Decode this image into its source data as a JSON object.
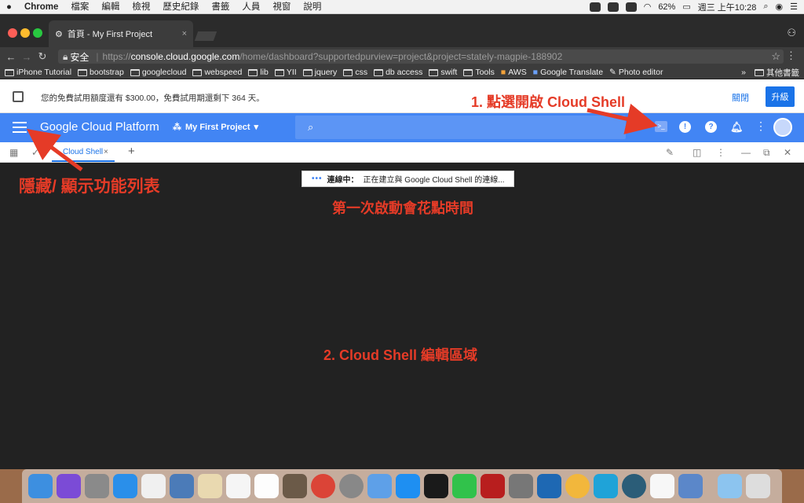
{
  "menubar": {
    "apple": "",
    "app": "Chrome",
    "items": [
      "檔案",
      "編輯",
      "檢視",
      "歷史紀錄",
      "書籤",
      "人員",
      "視窗",
      "說明"
    ],
    "battery": "62%",
    "clock": "週三 上午10:28"
  },
  "browser": {
    "tab_title": "首頁 - My First Project",
    "tab_close": "×",
    "secure_label": "安全",
    "url_scheme": "https://",
    "url_host": "console.cloud.google.com",
    "url_path": "/home/dashboard?supportedpurview=project&project=stately-magpie-188902"
  },
  "bookmarks": {
    "items": [
      "iPhone Tutorial",
      "bootstrap",
      "googlecloud",
      "webspeed",
      "lib",
      "YII",
      "jquery",
      "css",
      "db access",
      "swift",
      "Tools",
      "AWS",
      "Google Translate",
      "Photo editor"
    ],
    "overflow": "»",
    "other": "其他書籤"
  },
  "promo": {
    "text": "您的免費試用額度還有 $300.00，免費試用期還剩下 364 天。",
    "dismiss": "關閉",
    "upgrade": "升級"
  },
  "gcp": {
    "title": "Google Cloud Platform",
    "project": "My First Project"
  },
  "shell": {
    "tab_label": "Cloud Shell",
    "tab_close": "×",
    "add": "+",
    "connecting_label": "連線中：",
    "connecting_text": "正在建立與 Google Cloud Shell 的連線..."
  },
  "annotations": {
    "step1": "1. 點選開啟 Cloud Shell",
    "menu_toggle": "隱藏/ 顯示功能列表",
    "first_start": "第一次啟動會花點時間",
    "step2": "2. Cloud Shell 編輯區域"
  },
  "colors": {
    "gcp_blue": "#4285f4",
    "annotation_red": "#e53b27",
    "terminal_bg": "#222222"
  },
  "icons": {
    "shell": "terminal-icon",
    "feedback": "feedback-icon",
    "help": "help-icon",
    "notifications": "bell-icon",
    "more": "more-vert-icon",
    "account": "avatar"
  }
}
